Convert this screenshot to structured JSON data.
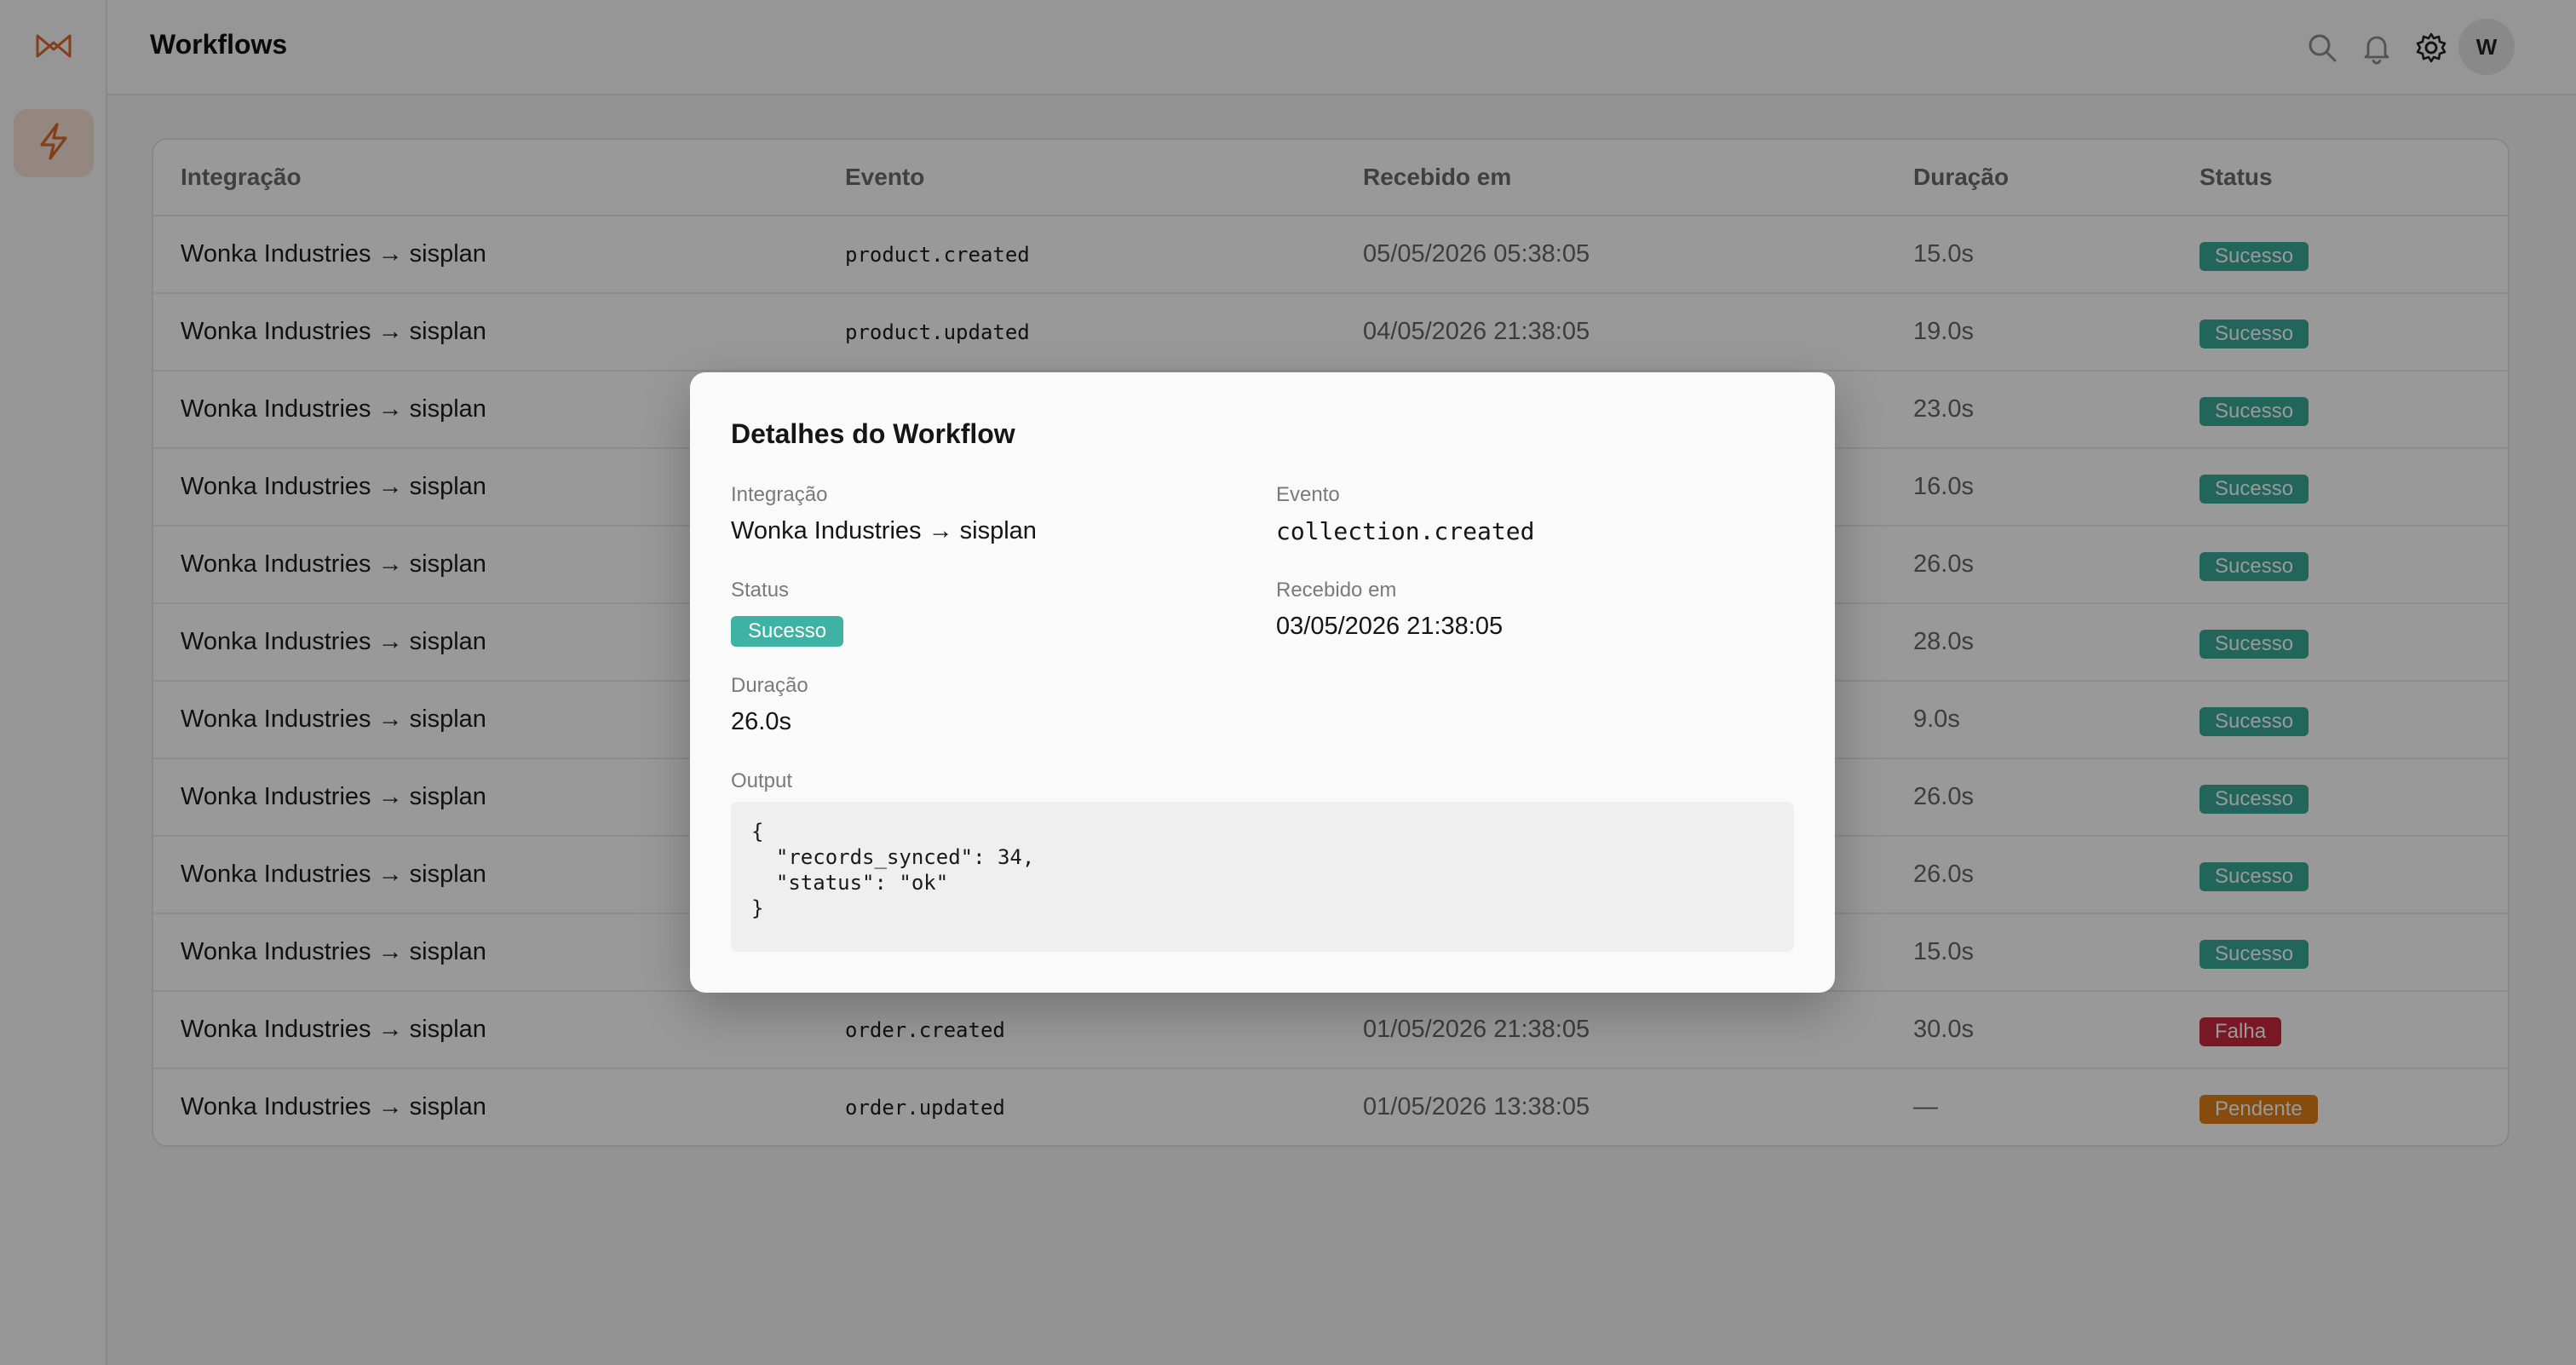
{
  "header": {
    "title": "Workflows",
    "avatar_initial": "W"
  },
  "table": {
    "columns": [
      "Integração",
      "Evento",
      "Recebido em",
      "Duração",
      "Status"
    ],
    "rows": [
      {
        "integration": "Wonka Industries → sisplan",
        "event": "product.created",
        "received": "05/05/2026 05:38:05",
        "duration": "15.0s",
        "status": "Sucesso"
      },
      {
        "integration": "Wonka Industries → sisplan",
        "event": "product.updated",
        "received": "04/05/2026 21:38:05",
        "duration": "19.0s",
        "status": "Sucesso"
      },
      {
        "integration": "Wonka Industries → sisplan",
        "event": "",
        "received": "",
        "duration": "23.0s",
        "status": "Sucesso"
      },
      {
        "integration": "Wonka Industries → sisplan",
        "event": "",
        "received": "",
        "duration": "16.0s",
        "status": "Sucesso"
      },
      {
        "integration": "Wonka Industries → sisplan",
        "event": "",
        "received": "",
        "duration": "26.0s",
        "status": "Sucesso"
      },
      {
        "integration": "Wonka Industries → sisplan",
        "event": "",
        "received": "",
        "duration": "28.0s",
        "status": "Sucesso"
      },
      {
        "integration": "Wonka Industries → sisplan",
        "event": "",
        "received": "",
        "duration": "9.0s",
        "status": "Sucesso"
      },
      {
        "integration": "Wonka Industries → sisplan",
        "event": "",
        "received": "",
        "duration": "26.0s",
        "status": "Sucesso"
      },
      {
        "integration": "Wonka Industries → sisplan",
        "event": "",
        "received": "",
        "duration": "26.0s",
        "status": "Sucesso"
      },
      {
        "integration": "Wonka Industries → sisplan",
        "event": "",
        "received": "",
        "duration": "15.0s",
        "status": "Sucesso"
      },
      {
        "integration": "Wonka Industries → sisplan",
        "event": "order.created",
        "received": "01/05/2026 21:38:05",
        "duration": "30.0s",
        "status": "Falha"
      },
      {
        "integration": "Wonka Industries → sisplan",
        "event": "order.updated",
        "received": "01/05/2026 13:38:05",
        "duration": "—",
        "status": "Pendente"
      }
    ]
  },
  "modal": {
    "title": "Detalhes do Workflow",
    "integration_label": "Integração",
    "integration_value": "Wonka Industries → sisplan",
    "event_label": "Evento",
    "event_value": "collection.created",
    "status_label": "Status",
    "status_value": "Sucesso",
    "received_label": "Recebido em",
    "received_value": "03/05/2026 21:38:05",
    "duration_label": "Duração",
    "duration_value": "26.0s",
    "output_label": "Output",
    "output_value": "{\n  \"records_synced\": 34,\n  \"status\": \"ok\"\n}"
  },
  "colors": {
    "accent": "#d9692a",
    "success": "#3aa898",
    "fail": "#c8283e",
    "pending": "#e07f17"
  },
  "icons": [
    "logo-icon",
    "lightning-icon",
    "search-icon",
    "bell-icon",
    "gear-icon"
  ]
}
